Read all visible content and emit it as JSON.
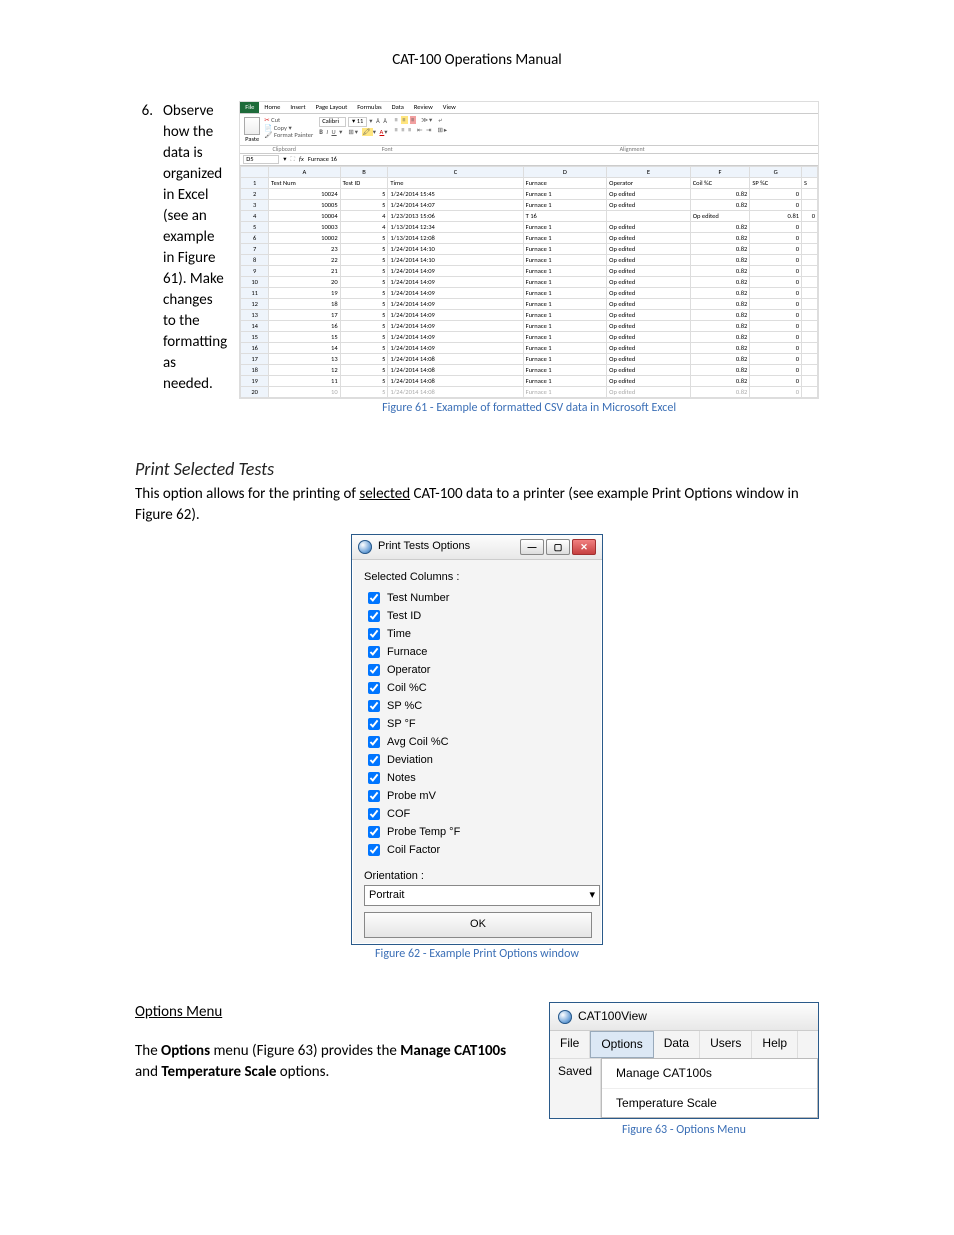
{
  "header": {
    "title": "CAT-100 Operations Manual"
  },
  "step6": {
    "number": "6.",
    "text": "Observe how the data is organized in Excel (see an example in Figure 61). Make changes to the formatting as needed."
  },
  "excel": {
    "tabs": {
      "file": "File",
      "home": "Home",
      "insert": "Insert",
      "pageLayout": "Page Layout",
      "formulas": "Formulas",
      "data": "Data",
      "review": "Review",
      "view": "View"
    },
    "clipboard": {
      "paste": "Paste",
      "cut": "Cut",
      "copy": "Copy ▾",
      "formatPainter": "Format Painter",
      "groupLabel": "Clipboard"
    },
    "font": {
      "name": "Calibri",
      "size": "11",
      "groupLabel": "Font"
    },
    "alignment": {
      "groupLabel": "Alignment"
    },
    "cellRef": "D5",
    "fx": "fx",
    "formulaValue": "Furnace 16",
    "cols": [
      "",
      "A",
      "B",
      "C",
      "D",
      "E",
      "F",
      "G",
      ""
    ],
    "hrow": [
      "1",
      "Test Num",
      "Test ID",
      "Time",
      "Furnace",
      "Operator",
      "Coil %C",
      "SP %C",
      "S"
    ],
    "rows": [
      [
        "2",
        "10024",
        "5",
        "1/24/2014 15:45",
        "Furnace 1",
        "Op edited",
        "0.82",
        "0"
      ],
      [
        "3",
        "10005",
        "5",
        "1/24/2014 14:07",
        "Furnace 1",
        "Op edited",
        "0.82",
        "0"
      ],
      [
        "4",
        "10004",
        "4",
        "1/23/2013 15:06",
        "T 16",
        "",
        "Op edited",
        "0.81",
        "0"
      ],
      [
        "5",
        "10003",
        "4",
        "1/13/2014 12:34",
        "Furnace 1",
        "Op edited",
        "0.82",
        "0"
      ],
      [
        "6",
        "10002",
        "5",
        "1/13/2014 12:08",
        "Furnace 1",
        "Op edited",
        "0.82",
        "0"
      ],
      [
        "7",
        "23",
        "5",
        "1/24/2014 14:10",
        "Furnace 1",
        "Op edited",
        "0.82",
        "0"
      ],
      [
        "8",
        "22",
        "5",
        "1/24/2014 14:10",
        "Furnace 1",
        "Op edited",
        "0.82",
        "0"
      ],
      [
        "9",
        "21",
        "5",
        "1/24/2014 14:09",
        "Furnace 1",
        "Op edited",
        "0.82",
        "0"
      ],
      [
        "10",
        "20",
        "5",
        "1/24/2014 14:09",
        "Furnace 1",
        "Op edited",
        "0.82",
        "0"
      ],
      [
        "11",
        "19",
        "5",
        "1/24/2014 14:09",
        "Furnace 1",
        "Op edited",
        "0.82",
        "0"
      ],
      [
        "12",
        "18",
        "5",
        "1/24/2014 14:09",
        "Furnace 1",
        "Op edited",
        "0.82",
        "0"
      ],
      [
        "13",
        "17",
        "5",
        "1/24/2014 14:09",
        "Furnace 1",
        "Op edited",
        "0.82",
        "0"
      ],
      [
        "14",
        "16",
        "5",
        "1/24/2014 14:09",
        "Furnace 1",
        "Op edited",
        "0.82",
        "0"
      ],
      [
        "15",
        "15",
        "5",
        "1/24/2014 14:09",
        "Furnace 1",
        "Op edited",
        "0.82",
        "0"
      ],
      [
        "16",
        "14",
        "5",
        "1/24/2014 14:09",
        "Furnace 1",
        "Op edited",
        "0.82",
        "0"
      ],
      [
        "17",
        "13",
        "5",
        "1/24/2014 14:08",
        "Furnace 1",
        "Op edited",
        "0.82",
        "0"
      ],
      [
        "18",
        "12",
        "5",
        "1/24/2014 14:08",
        "Furnace 1",
        "Op edited",
        "0.82",
        "0"
      ],
      [
        "19",
        "11",
        "5",
        "1/24/2014 14:08",
        "Furnace 1",
        "Op edited",
        "0.82",
        "0"
      ],
      [
        "20",
        "10",
        "5",
        "1/24/2014 14:08",
        "Furnace 1",
        "Op edited",
        "0.82",
        "0"
      ]
    ],
    "caption": "Figure 61 - Example of formatted CSV data in Microsoft Excel"
  },
  "printSection": {
    "heading": "Print Selected Tests",
    "body_pre": "This option allows for the printing of ",
    "body_underline": "selected",
    "body_post": " CAT-100 data to a printer (see example Print Options window in Figure 62)."
  },
  "printDialog": {
    "title": "Print Tests Options",
    "selHeader": "Selected Columns :",
    "items": [
      "Test Number",
      "Test ID",
      "Time",
      "Furnace",
      "Operator",
      "Coil %C",
      "SP %C",
      "SP °F",
      "Avg Coil %C",
      "Deviation",
      "Notes",
      "Probe mV",
      "COF",
      "Probe Temp °F",
      "Coil Factor"
    ],
    "orientLabel": "Orientation :",
    "orientValue": "Portrait",
    "ok": "OK",
    "caption": "Figure 62 - Example Print Options window"
  },
  "optionsSection": {
    "heading": "Options Menu",
    "body_p1a": "The ",
    "body_p1b": "Options",
    "body_p1c": " menu (Figure 63) provides the ",
    "body_p1d": "Manage CAT100s",
    "body_p1e": " and ",
    "body_p1f": "Temperature Scale",
    "body_p1g": " options."
  },
  "catMenu": {
    "title": "CAT100View",
    "file": "File",
    "options": "Options",
    "data": "Data",
    "users": "Users",
    "help": "Help",
    "saved": "Saved",
    "sub1": "Manage CAT100s",
    "sub2": "Temperature Scale",
    "caption": "Figure 63 - Options Menu"
  }
}
